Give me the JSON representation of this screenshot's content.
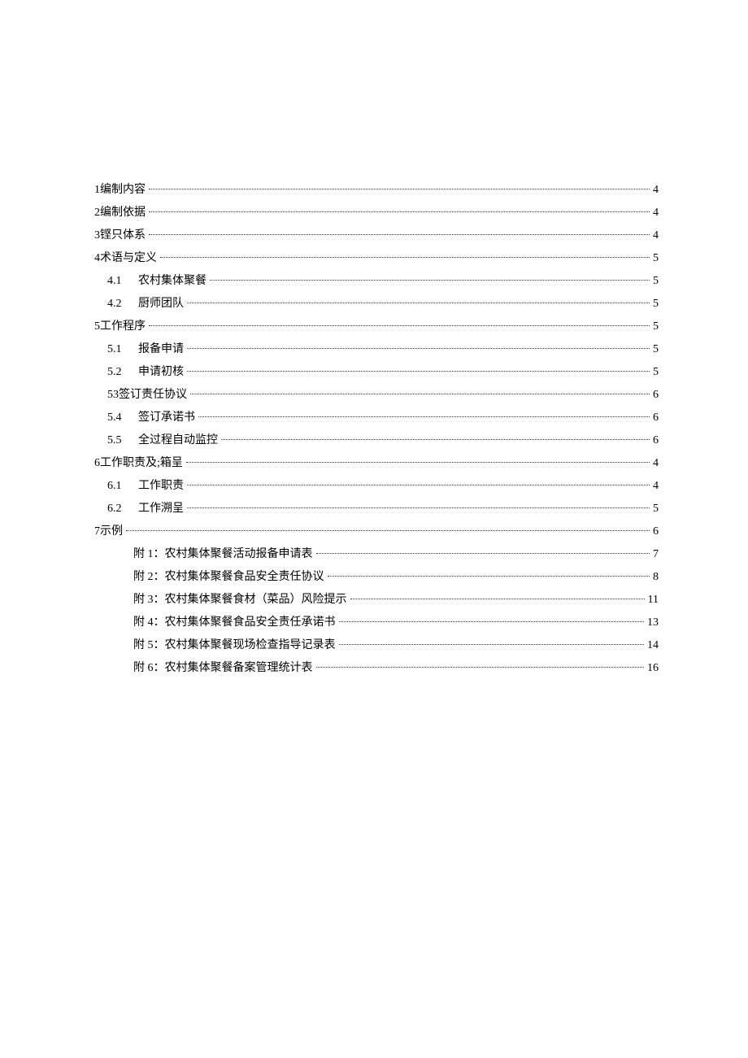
{
  "toc": [
    {
      "indent": 0,
      "num": "1",
      "label": "编制内容",
      "page": "4",
      "wide": false
    },
    {
      "indent": 0,
      "num": "2",
      "label": "编制依据",
      "page": "4",
      "wide": false
    },
    {
      "indent": 0,
      "num": "3",
      "label": "铿只体系",
      "page": "4",
      "wide": false
    },
    {
      "indent": 0,
      "num": "4",
      "label": "术语与定义",
      "page": "5",
      "wide": false
    },
    {
      "indent": 1,
      "num": "4.1",
      "label": "农村集体聚餐",
      "page": "5",
      "wide": true
    },
    {
      "indent": 1,
      "num": "4.2",
      "label": "厨师团队",
      "page": "5",
      "wide": true
    },
    {
      "indent": 0,
      "num": "5",
      "label": "工作程序",
      "page": "5",
      "wide": false
    },
    {
      "indent": 1,
      "num": "5.1",
      "label": "报备申请",
      "page": "5",
      "wide": true
    },
    {
      "indent": 1,
      "num": "5.2",
      "label": "申请初核",
      "page": "5",
      "wide": true
    },
    {
      "indent": 1,
      "num": "53",
      "label": "签订责任协议",
      "page": "6",
      "wide": false
    },
    {
      "indent": 1,
      "num": "5.4",
      "label": "签订承诺书",
      "page": "6",
      "wide": true
    },
    {
      "indent": 1,
      "num": "5.5",
      "label": "全过程自动监控",
      "page": "6",
      "wide": true
    },
    {
      "indent": 0,
      "num": "6",
      "label": "工作职责及;箱呈",
      "page": "4",
      "wide": false
    },
    {
      "indent": 1,
      "num": "6.1",
      "label": "工作职责",
      "page": "4",
      "wide": true
    },
    {
      "indent": 1,
      "num": "6.2",
      "label": "工作溯呈",
      "page": "5",
      "wide": true
    },
    {
      "indent": 0,
      "num": "7",
      "label": "示例",
      "page": "6",
      "wide": false
    },
    {
      "indent": 2,
      "num": "",
      "label": "附 1：农村集体聚餐活动报备申请表",
      "page": "7",
      "wide": false
    },
    {
      "indent": 2,
      "num": "",
      "label": "附 2：农村集体聚餐食品安全责任协议",
      "page": "8",
      "wide": false
    },
    {
      "indent": 2,
      "num": "",
      "label": "附 3：农村集体聚餐食材（菜品）风险提示",
      "page": "11",
      "wide": false
    },
    {
      "indent": 2,
      "num": "",
      "label": "附 4：农村集体聚餐食品安全责任承诺书",
      "page": "13",
      "wide": false
    },
    {
      "indent": 2,
      "num": "",
      "label": "附 5：农村集体聚餐现场检查指导记录表",
      "page": "14",
      "wide": false
    },
    {
      "indent": 2,
      "num": "",
      "label": "附 6：农村集体聚餐备案管理统计表",
      "page": "16",
      "wide": false
    }
  ]
}
